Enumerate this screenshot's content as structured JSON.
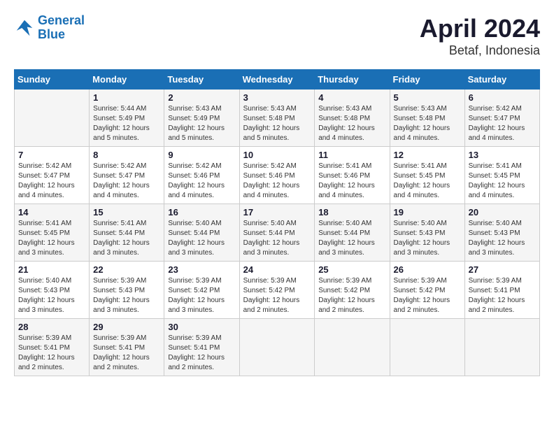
{
  "header": {
    "logo_line1": "General",
    "logo_line2": "Blue",
    "month_year": "April 2024",
    "location": "Betaf, Indonesia"
  },
  "days_of_week": [
    "Sunday",
    "Monday",
    "Tuesday",
    "Wednesday",
    "Thursday",
    "Friday",
    "Saturday"
  ],
  "weeks": [
    [
      {
        "day": "",
        "info": ""
      },
      {
        "day": "1",
        "info": "Sunrise: 5:44 AM\nSunset: 5:49 PM\nDaylight: 12 hours\nand 5 minutes."
      },
      {
        "day": "2",
        "info": "Sunrise: 5:43 AM\nSunset: 5:49 PM\nDaylight: 12 hours\nand 5 minutes."
      },
      {
        "day": "3",
        "info": "Sunrise: 5:43 AM\nSunset: 5:48 PM\nDaylight: 12 hours\nand 5 minutes."
      },
      {
        "day": "4",
        "info": "Sunrise: 5:43 AM\nSunset: 5:48 PM\nDaylight: 12 hours\nand 4 minutes."
      },
      {
        "day": "5",
        "info": "Sunrise: 5:43 AM\nSunset: 5:48 PM\nDaylight: 12 hours\nand 4 minutes."
      },
      {
        "day": "6",
        "info": "Sunrise: 5:42 AM\nSunset: 5:47 PM\nDaylight: 12 hours\nand 4 minutes."
      }
    ],
    [
      {
        "day": "7",
        "info": "Sunrise: 5:42 AM\nSunset: 5:47 PM\nDaylight: 12 hours\nand 4 minutes."
      },
      {
        "day": "8",
        "info": "Sunrise: 5:42 AM\nSunset: 5:47 PM\nDaylight: 12 hours\nand 4 minutes."
      },
      {
        "day": "9",
        "info": "Sunrise: 5:42 AM\nSunset: 5:46 PM\nDaylight: 12 hours\nand 4 minutes."
      },
      {
        "day": "10",
        "info": "Sunrise: 5:42 AM\nSunset: 5:46 PM\nDaylight: 12 hours\nand 4 minutes."
      },
      {
        "day": "11",
        "info": "Sunrise: 5:41 AM\nSunset: 5:46 PM\nDaylight: 12 hours\nand 4 minutes."
      },
      {
        "day": "12",
        "info": "Sunrise: 5:41 AM\nSunset: 5:45 PM\nDaylight: 12 hours\nand 4 minutes."
      },
      {
        "day": "13",
        "info": "Sunrise: 5:41 AM\nSunset: 5:45 PM\nDaylight: 12 hours\nand 4 minutes."
      }
    ],
    [
      {
        "day": "14",
        "info": "Sunrise: 5:41 AM\nSunset: 5:45 PM\nDaylight: 12 hours\nand 3 minutes."
      },
      {
        "day": "15",
        "info": "Sunrise: 5:41 AM\nSunset: 5:44 PM\nDaylight: 12 hours\nand 3 minutes."
      },
      {
        "day": "16",
        "info": "Sunrise: 5:40 AM\nSunset: 5:44 PM\nDaylight: 12 hours\nand 3 minutes."
      },
      {
        "day": "17",
        "info": "Sunrise: 5:40 AM\nSunset: 5:44 PM\nDaylight: 12 hours\nand 3 minutes."
      },
      {
        "day": "18",
        "info": "Sunrise: 5:40 AM\nSunset: 5:44 PM\nDaylight: 12 hours\nand 3 minutes."
      },
      {
        "day": "19",
        "info": "Sunrise: 5:40 AM\nSunset: 5:43 PM\nDaylight: 12 hours\nand 3 minutes."
      },
      {
        "day": "20",
        "info": "Sunrise: 5:40 AM\nSunset: 5:43 PM\nDaylight: 12 hours\nand 3 minutes."
      }
    ],
    [
      {
        "day": "21",
        "info": "Sunrise: 5:40 AM\nSunset: 5:43 PM\nDaylight: 12 hours\nand 3 minutes."
      },
      {
        "day": "22",
        "info": "Sunrise: 5:39 AM\nSunset: 5:43 PM\nDaylight: 12 hours\nand 3 minutes."
      },
      {
        "day": "23",
        "info": "Sunrise: 5:39 AM\nSunset: 5:42 PM\nDaylight: 12 hours\nand 3 minutes."
      },
      {
        "day": "24",
        "info": "Sunrise: 5:39 AM\nSunset: 5:42 PM\nDaylight: 12 hours\nand 2 minutes."
      },
      {
        "day": "25",
        "info": "Sunrise: 5:39 AM\nSunset: 5:42 PM\nDaylight: 12 hours\nand 2 minutes."
      },
      {
        "day": "26",
        "info": "Sunrise: 5:39 AM\nSunset: 5:42 PM\nDaylight: 12 hours\nand 2 minutes."
      },
      {
        "day": "27",
        "info": "Sunrise: 5:39 AM\nSunset: 5:41 PM\nDaylight: 12 hours\nand 2 minutes."
      }
    ],
    [
      {
        "day": "28",
        "info": "Sunrise: 5:39 AM\nSunset: 5:41 PM\nDaylight: 12 hours\nand 2 minutes."
      },
      {
        "day": "29",
        "info": "Sunrise: 5:39 AM\nSunset: 5:41 PM\nDaylight: 12 hours\nand 2 minutes."
      },
      {
        "day": "30",
        "info": "Sunrise: 5:39 AM\nSunset: 5:41 PM\nDaylight: 12 hours\nand 2 minutes."
      },
      {
        "day": "",
        "info": ""
      },
      {
        "day": "",
        "info": ""
      },
      {
        "day": "",
        "info": ""
      },
      {
        "day": "",
        "info": ""
      }
    ]
  ]
}
